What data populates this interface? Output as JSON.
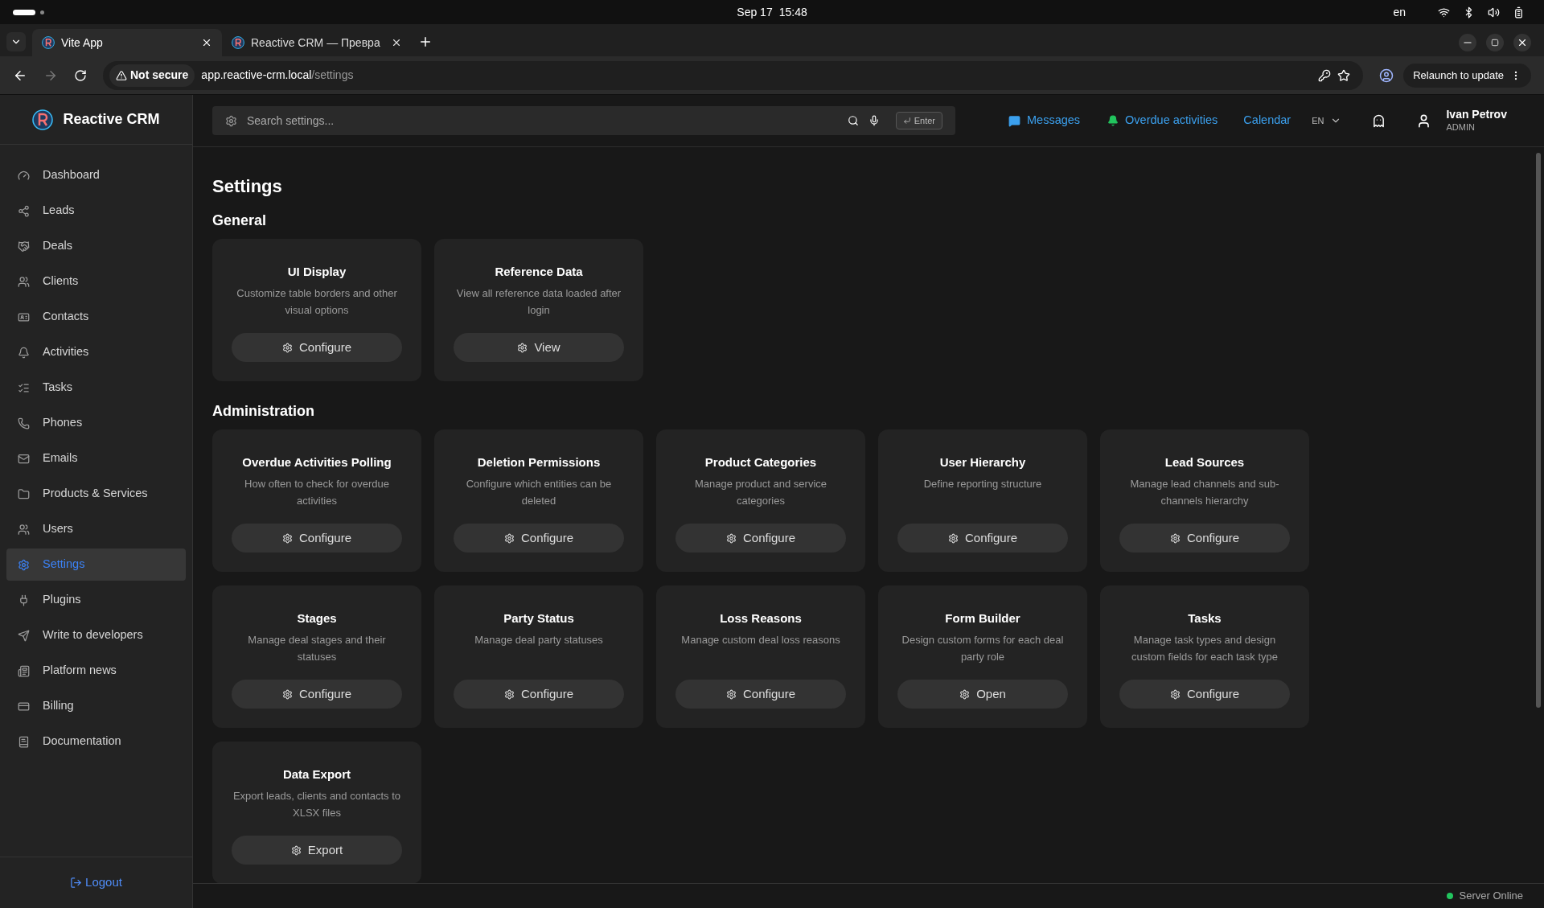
{
  "os_bar": {
    "date": "Sep 17",
    "time": "15:48",
    "language": "en"
  },
  "browser": {
    "tabs": [
      {
        "title": "Vite App",
        "selected": true
      },
      {
        "title": "Reactive CRM — Превра",
        "selected": false
      }
    ],
    "security": "Not secure",
    "url_host": "app.reactive-crm.local",
    "url_path": "/settings",
    "relaunch": "Relaunch to update"
  },
  "sidebar": {
    "brand": "Reactive CRM",
    "items": [
      {
        "label": "Dashboard",
        "selected": false
      },
      {
        "label": "Leads",
        "selected": false
      },
      {
        "label": "Deals",
        "selected": false
      },
      {
        "label": "Clients",
        "selected": false
      },
      {
        "label": "Contacts",
        "selected": false
      },
      {
        "label": "Activities",
        "selected": false
      },
      {
        "label": "Tasks",
        "selected": false
      },
      {
        "label": "Phones",
        "selected": false
      },
      {
        "label": "Emails",
        "selected": false
      },
      {
        "label": "Products & Services",
        "selected": false
      },
      {
        "label": "Users",
        "selected": false
      },
      {
        "label": "Settings",
        "selected": true
      },
      {
        "label": "Plugins",
        "selected": false
      },
      {
        "label": "Write to developers",
        "selected": false
      },
      {
        "label": "Platform news",
        "selected": false
      },
      {
        "label": "Billing",
        "selected": false
      },
      {
        "label": "Documentation",
        "selected": false
      }
    ],
    "logout": "Logout"
  },
  "header": {
    "search": {
      "placeholder": "Search settings...",
      "enter_key": "Enter"
    },
    "messages": "Messages",
    "overdue": "Overdue activities",
    "calendar": "Calendar",
    "language": "EN",
    "user_name": "Ivan Petrov",
    "user_role": "ADMIN"
  },
  "page_title": "Settings",
  "sections": [
    {
      "title": "General",
      "cards": [
        {
          "title": "UI Display",
          "description": "Customize table borders and other visual options",
          "button": "Configure"
        },
        {
          "title": "Reference Data",
          "description": "View all reference data loaded after login",
          "button": "View"
        }
      ]
    },
    {
      "title": "Administration",
      "cards": [
        {
          "title": "Overdue Activities Polling",
          "description": "How often to check for overdue activities",
          "button": "Configure"
        },
        {
          "title": "Deletion Permissions",
          "description": "Configure which entities can be deleted",
          "button": "Configure"
        },
        {
          "title": "Product Categories",
          "description": "Manage product and service categories",
          "button": "Configure"
        },
        {
          "title": "User Hierarchy",
          "description": "Define reporting structure",
          "button": "Configure"
        },
        {
          "title": "Lead Sources",
          "description": "Manage lead channels and sub-channels hierarchy",
          "button": "Configure"
        },
        {
          "title": "Stages",
          "description": "Manage deal stages and their statuses",
          "button": "Configure"
        },
        {
          "title": "Party Status",
          "description": "Manage deal party statuses",
          "button": "Configure"
        },
        {
          "title": "Loss Reasons",
          "description": "Manage custom deal loss reasons",
          "button": "Configure"
        },
        {
          "title": "Form Builder",
          "description": "Design custom forms for each deal party role",
          "button": "Open"
        },
        {
          "title": "Tasks",
          "description": "Manage task types and design custom fields for each task type",
          "button": "Configure"
        },
        {
          "title": "Data Export",
          "description": "Export leads, clients and contacts to XLSX files",
          "button": "Export"
        }
      ]
    }
  ],
  "status": {
    "text": "Server Online",
    "color": "#22c55e"
  }
}
